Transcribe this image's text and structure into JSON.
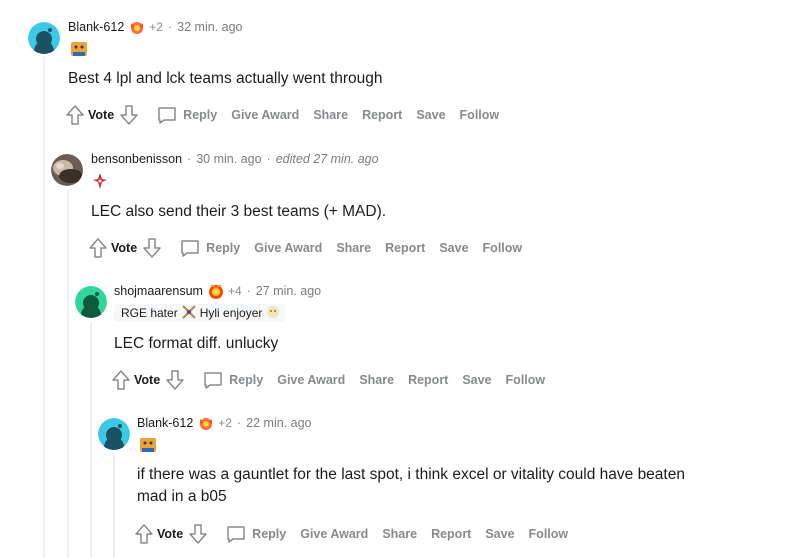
{
  "comments": [
    {
      "username": "Blank-612",
      "award_count": "+2",
      "time": "32 min. ago",
      "body": "Best 4 lpl and lck teams actually went through",
      "actions": {
        "vote": "Vote",
        "reply": "Reply",
        "give_award": "Give Award",
        "share": "Share",
        "report": "Report",
        "save": "Save",
        "follow": "Follow"
      }
    },
    {
      "username": "bensonbenisson",
      "time": "30 min. ago",
      "edited": "edited 27 min. ago",
      "body": "LEC also send their 3 best teams (+ MAD).",
      "actions": {
        "vote": "Vote",
        "reply": "Reply",
        "give_award": "Give Award",
        "share": "Share",
        "report": "Report",
        "save": "Save",
        "follow": "Follow"
      }
    },
    {
      "username": "shojmaarensum",
      "award_count": "+4",
      "time": "27 min. ago",
      "flair": {
        "text_left": "RGE hater",
        "text_right": "Hyli enjoyer"
      },
      "body": "LEC format diff. unlucky",
      "actions": {
        "vote": "Vote",
        "reply": "Reply",
        "give_award": "Give Award",
        "share": "Share",
        "report": "Report",
        "save": "Save",
        "follow": "Follow"
      }
    },
    {
      "username": "Blank-612",
      "award_count": "+2",
      "time": "22 min. ago",
      "body_line1": "if there was a gauntlet for the last spot, i think excel or vitality could have beaten",
      "body_line2": "mad in a b05",
      "actions": {
        "vote": "Vote",
        "reply": "Reply",
        "give_award": "Give Award",
        "share": "Share",
        "report": "Report",
        "save": "Save",
        "follow": "Follow"
      }
    }
  ],
  "colors": {
    "avatar_teal": "#3cc9e8",
    "avatar_green": "#2fd69a",
    "meta_gray": "#878a8c",
    "thread_line": "#edeff1"
  }
}
